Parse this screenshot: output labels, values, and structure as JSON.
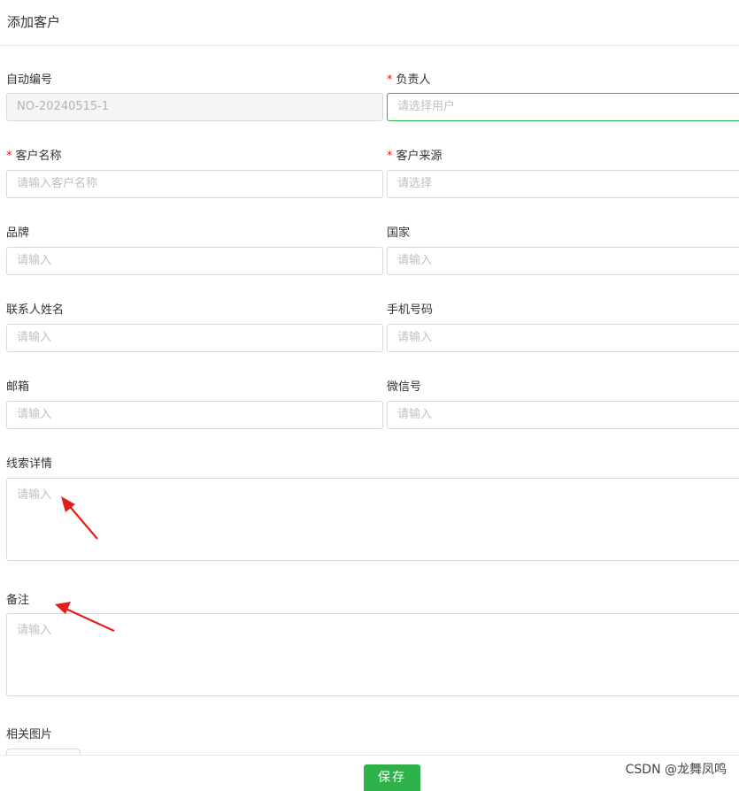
{
  "header": {
    "title": "添加客户"
  },
  "form": {
    "auto_no": {
      "label": "自动编号",
      "value": "NO-20240515-1"
    },
    "owner": {
      "label": "负责人",
      "required_mark": "*",
      "placeholder": "请选择用户"
    },
    "customer_name": {
      "label": "客户名称",
      "required_mark": "*",
      "placeholder": "请输入客户名称"
    },
    "customer_source": {
      "label": "客户来源",
      "required_mark": "*",
      "placeholder": "请选择"
    },
    "brand": {
      "label": "品牌",
      "placeholder": "请输入"
    },
    "country": {
      "label": "国家",
      "placeholder": "请输入"
    },
    "contact_name": {
      "label": "联系人姓名",
      "placeholder": "请输入"
    },
    "mobile": {
      "label": "手机号码",
      "placeholder": "请输入"
    },
    "email": {
      "label": "邮箱",
      "placeholder": "请输入"
    },
    "wechat": {
      "label": "微信号",
      "placeholder": "请输入"
    },
    "lead_details": {
      "label": "线索详情",
      "placeholder": "请输入"
    },
    "remarks": {
      "label": "备注",
      "placeholder": "请输入"
    },
    "images": {
      "label": "相关图片"
    }
  },
  "footer": {
    "save_label": "保存"
  },
  "watermark": "CSDN @龙舞凤鸣",
  "colors": {
    "accent": "#2fb14a",
    "required": "#e0201a",
    "annotation_arrow": "#e0201a"
  }
}
